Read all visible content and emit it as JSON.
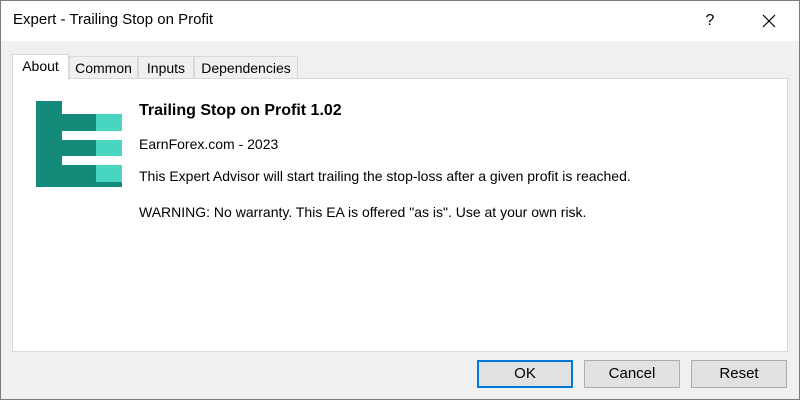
{
  "window": {
    "title": "Expert - Trailing Stop on Profit",
    "help_label": "?"
  },
  "tabs": [
    {
      "label": "About",
      "active": true
    },
    {
      "label": "Common",
      "active": false
    },
    {
      "label": "Inputs",
      "active": false
    },
    {
      "label": "Dependencies",
      "active": false
    }
  ],
  "about": {
    "logo_icon": "earnforex-e-logo-icon",
    "logo_colors": {
      "dark": "#138a7a",
      "light": "#48d6c0"
    },
    "title": "Trailing Stop on Profit 1.02",
    "copyright": "EarnForex.com - 2023",
    "description": "This Expert Advisor will start trailing the stop-loss after a given profit is reached.",
    "warning": "WARNING: No warranty. This EA is offered \"as is\". Use at your own risk."
  },
  "buttons": {
    "ok": "OK",
    "cancel": "Cancel",
    "reset": "Reset"
  },
  "colors": {
    "accent": "#0078d7"
  }
}
